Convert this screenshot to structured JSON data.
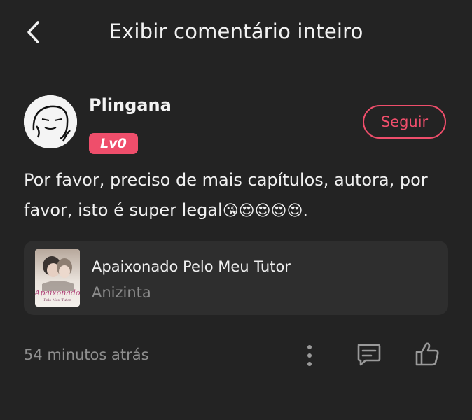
{
  "header": {
    "back_icon": "chevron-left-icon",
    "title": "Exibir comentário inteiro"
  },
  "user": {
    "name": "Plingana",
    "level": "Lv0",
    "follow_label": "Seguir",
    "accent_color": "#ef4e6b"
  },
  "comment": {
    "text": "Por favor, preciso de mais capítulos, autora, por favor, isto é super legal",
    "emojis": "😘😍😍😍😍",
    "trailing": "."
  },
  "book": {
    "title": "Apaixonado Pelo Meu Tutor",
    "author": "Anizinta",
    "cover_text": "Apaixonado",
    "cover_subtext": "Pelo Meu Tutor"
  },
  "footer": {
    "timestamp": "54 minutos atrás",
    "more_icon": "more-vertical-icon",
    "reply_icon": "comment-icon",
    "like_icon": "thumbs-up-icon"
  }
}
